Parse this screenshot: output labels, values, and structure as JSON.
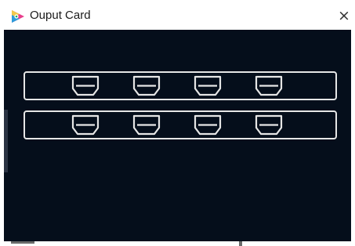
{
  "window": {
    "title": "Ouput Card",
    "close_glyph": "×",
    "app_icon": "app-logo-icon"
  },
  "colors": {
    "panel_background": "#050e1b",
    "outline": "#e6e6e6",
    "titlebar_background": "#ffffff"
  },
  "output_card": {
    "rows": [
      {
        "ports": [
          "hdmi-port-icon",
          "hdmi-port-icon",
          "hdmi-port-icon",
          "hdmi-port-icon"
        ]
      },
      {
        "ports": [
          "hdmi-port-icon",
          "hdmi-port-icon",
          "hdmi-port-icon",
          "hdmi-port-icon"
        ]
      }
    ]
  }
}
